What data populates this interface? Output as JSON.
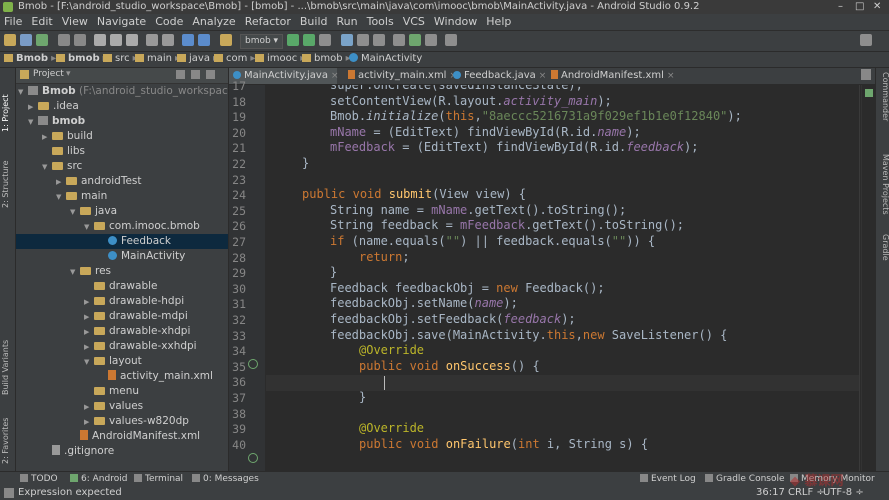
{
  "window": {
    "title": "Bmob - [F:\\android_studio_workspace\\Bmob] - [bmob] - ...\\bmob\\src\\main\\java\\com\\imooc\\bmob\\MainActivity.java - Android Studio 0.9.2",
    "controls": [
      "–",
      "□",
      "✕"
    ]
  },
  "menu": [
    "File",
    "Edit",
    "View",
    "Navigate",
    "Code",
    "Analyze",
    "Refactor",
    "Build",
    "Run",
    "Tools",
    "VCS",
    "Window",
    "Help"
  ],
  "toolbar": {
    "config_select": "bmob ▾"
  },
  "breadcrumb": [
    "Bmob",
    "bmob",
    "src",
    "main",
    "java",
    "com",
    "imooc",
    "bmob",
    "MainActivity"
  ],
  "left_tool_tabs": [
    "1: Project",
    "2: Structure",
    "Build Variants",
    "2: Favorites"
  ],
  "right_tool_tabs": [
    "Commander",
    "Maven Projects",
    "Gradle"
  ],
  "project_panel": {
    "view_label": "Project",
    "tree": [
      {
        "label": "Bmob",
        "extra": " (F:\\android_studio_workspace\\Bm",
        "icon": "module",
        "arrow": "▼"
      },
      {
        "label": ".idea",
        "icon": "folder",
        "arrow": "▶"
      },
      {
        "label": "bmob",
        "icon": "module",
        "arrow": "▼"
      },
      {
        "label": "build",
        "icon": "folder",
        "arrow": "▶"
      },
      {
        "label": "libs",
        "icon": "folder",
        "arrow": ""
      },
      {
        "label": "src",
        "icon": "folder",
        "arrow": "▼"
      },
      {
        "label": "androidTest",
        "icon": "folder",
        "arrow": "▶"
      },
      {
        "label": "main",
        "icon": "folder",
        "arrow": "▼"
      },
      {
        "label": "java",
        "icon": "folder",
        "arrow": "▼"
      },
      {
        "label": "com.imooc.bmob",
        "icon": "folder",
        "arrow": "▼"
      },
      {
        "label": "Feedback",
        "icon": "class",
        "arrow": ""
      },
      {
        "label": "MainActivity",
        "icon": "class",
        "arrow": ""
      },
      {
        "label": "res",
        "icon": "folder",
        "arrow": "▼"
      },
      {
        "label": "drawable",
        "icon": "folder",
        "arrow": ""
      },
      {
        "label": "drawable-hdpi",
        "icon": "folder",
        "arrow": "▶"
      },
      {
        "label": "drawable-mdpi",
        "icon": "folder",
        "arrow": "▶"
      },
      {
        "label": "drawable-xhdpi",
        "icon": "folder",
        "arrow": "▶"
      },
      {
        "label": "drawable-xxhdpi",
        "icon": "folder",
        "arrow": "▶"
      },
      {
        "label": "layout",
        "icon": "folder",
        "arrow": "▼"
      },
      {
        "label": "activity_main.xml",
        "icon": "xml",
        "arrow": ""
      },
      {
        "label": "menu",
        "icon": "folder",
        "arrow": ""
      },
      {
        "label": "values",
        "icon": "folder",
        "arrow": "▶"
      },
      {
        "label": "values-w820dp",
        "icon": "folder",
        "arrow": "▶"
      },
      {
        "label": "AndroidManifest.xml",
        "icon": "xml",
        "arrow": ""
      },
      {
        "label": ".gitignore",
        "icon": "file",
        "arrow": ""
      }
    ]
  },
  "tabs": [
    {
      "label": "MainActivity.java",
      "icon": "class",
      "active": true
    },
    {
      "label": "activity_main.xml",
      "icon": "xml",
      "active": false
    },
    {
      "label": "Feedback.java",
      "icon": "class",
      "active": false
    },
    {
      "label": "AndroidManifest.xml",
      "icon": "xml",
      "active": false
    }
  ],
  "editor": {
    "line_numbers": [
      "17",
      "18",
      "19",
      "20",
      "21",
      "22",
      "23",
      "24",
      "25",
      "26",
      "27",
      "28",
      "29",
      "30",
      "31",
      "32",
      "33",
      "34",
      "35",
      "36",
      "37",
      "38",
      "39",
      "40"
    ],
    "lines": [
      "super.onCreate(savedInstanceState);",
      "setContentView(R.layout.activity_main);",
      "Bmob.initialize(this,\"8aeccc5216731a9f029ef1b1e0f12840\");",
      "mName = (EditText) findViewById(R.id.name);",
      "mFeedback = (EditText) findViewById(R.id.feedback);",
      "}",
      "",
      "public void submit(View view) {",
      "String name = mName.getText().toString();",
      "String feedback = mFeedback.getText().toString();",
      "if (name.equals(\"\") || feedback.equals(\"\")) {",
      "return;",
      "}",
      "Feedback feedbackObj = new Feedback();",
      "feedbackObj.setName(name);",
      "feedbackObj.setFeedback(feedback);",
      "feedbackObj.save(MainActivity.this,new SaveListener() {",
      "@Override",
      "public void onSuccess() {",
      "",
      "}",
      "",
      "@Override",
      "public void onFailure(int i, String s) {"
    ]
  },
  "bottom_tools": [
    "TODO",
    "6: Android",
    "Terminal",
    "0: Messages",
    "Event Log",
    "Gradle Console",
    "Memory Monitor"
  ],
  "status": {
    "message": "Expression expected",
    "position": "36:17",
    "line_sep": "CRLF ÷",
    "encoding": "UTF-8 ÷"
  }
}
